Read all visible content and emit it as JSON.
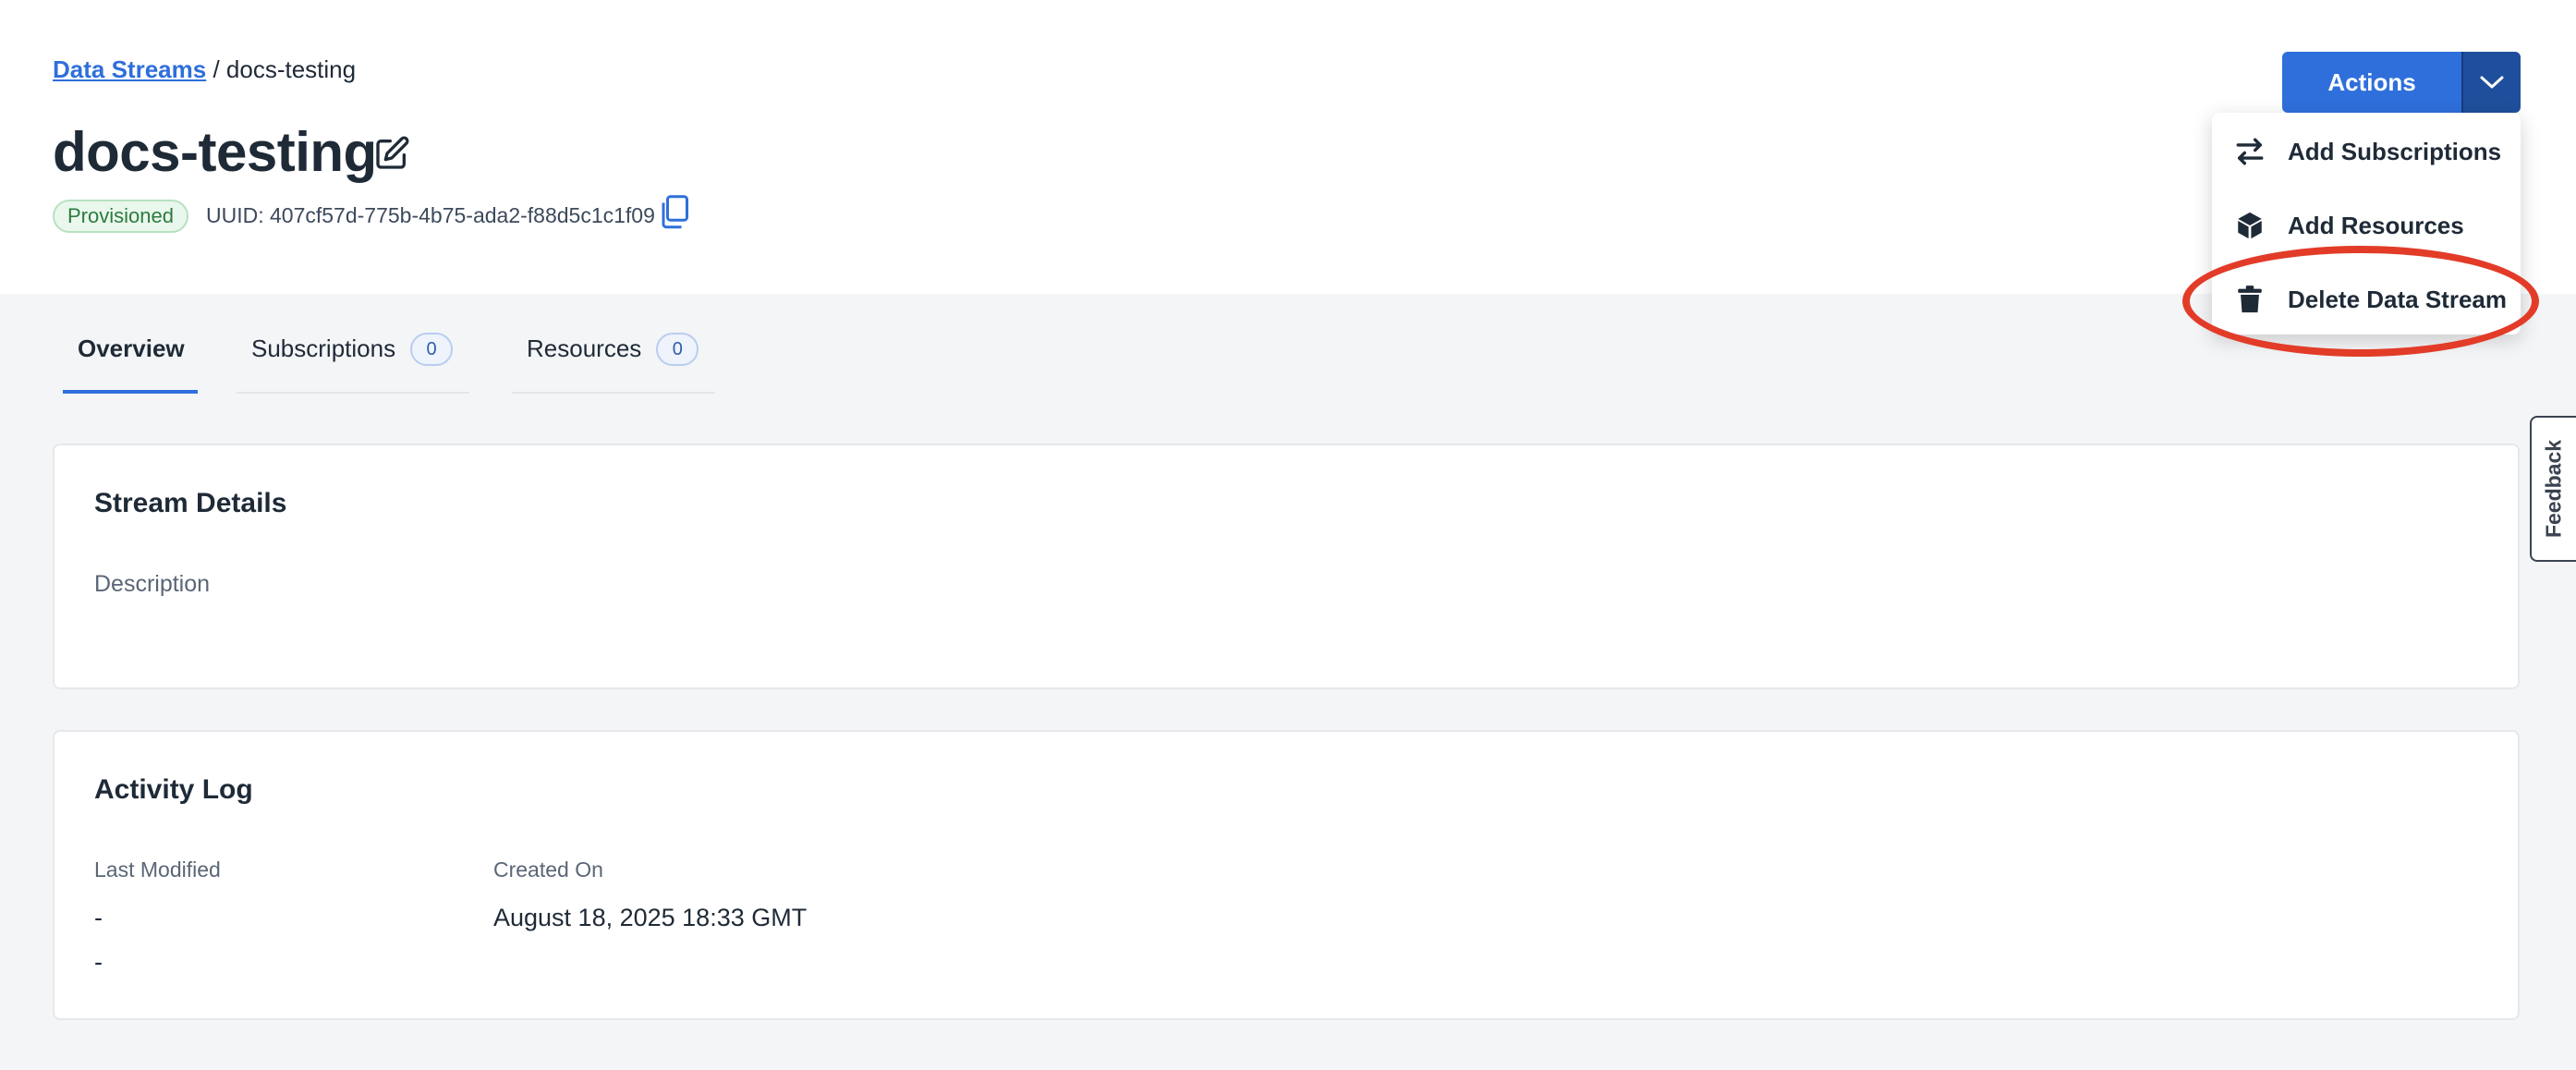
{
  "breadcrumb": {
    "root_label": "Data Streams",
    "separator": "/",
    "current_label": "docs-testing"
  },
  "header": {
    "title": "docs-testing",
    "status": "Provisioned",
    "uuid_label": "UUID: 407cf57d-775b-4b75-ada2-f88d5c1c1f09"
  },
  "actions": {
    "button_label": "Actions",
    "menu": [
      {
        "label": "Add Subscriptions",
        "icon": "swap-arrows-icon"
      },
      {
        "label": "Add Resources",
        "icon": "box-icon"
      },
      {
        "label": "Delete Data Stream",
        "icon": "trash-icon"
      }
    ]
  },
  "tabs": [
    {
      "label": "Overview"
    },
    {
      "label": "Subscriptions",
      "count": "0"
    },
    {
      "label": "Resources",
      "count": "0"
    }
  ],
  "stream_details": {
    "title": "Stream Details",
    "description_label": "Description"
  },
  "activity_log": {
    "title": "Activity Log",
    "last_modified_label": "Last Modified",
    "last_modified_value": "-",
    "last_modified_value_2": "-",
    "created_on_label": "Created On",
    "created_on_value": "August 18, 2025 18:33 GMT"
  },
  "feedback": {
    "label": "Feedback"
  },
  "colors": {
    "accent": "#2f6fdb",
    "accent_dark": "#1f4f9c",
    "highlight": "#e23c28",
    "status_green": "#2e7a3f"
  }
}
